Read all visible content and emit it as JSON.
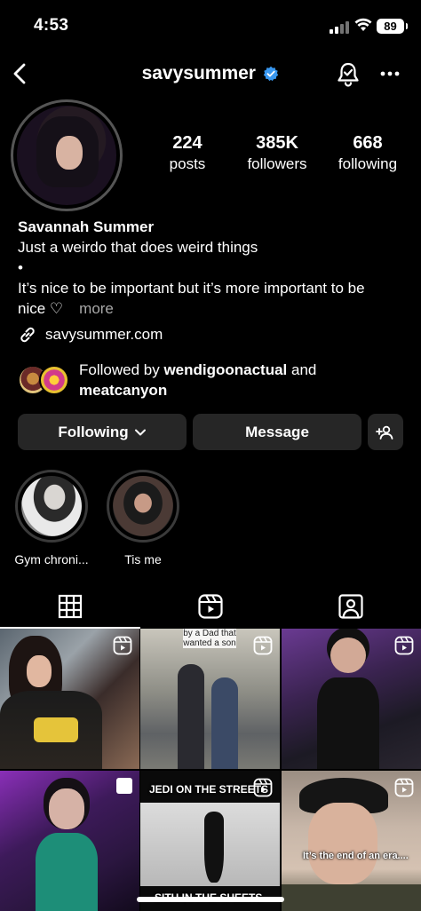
{
  "status_bar": {
    "time": "4:53",
    "battery": "89"
  },
  "header": {
    "username": "savysummer"
  },
  "stats": [
    {
      "value": "224",
      "label": "posts"
    },
    {
      "value": "385K",
      "label": "followers"
    },
    {
      "value": "668",
      "label": "following"
    }
  ],
  "bio": {
    "name": "Savannah Summer",
    "line1": "Just a weirdo that does weird things",
    "line2": "•",
    "line3": "It’s nice to be important but it’s more important to be",
    "line4": "nice ♡",
    "more": "more"
  },
  "link": {
    "text": "savysummer.com"
  },
  "followed_by": {
    "prefix": "Followed by ",
    "user1": "wendigoonactual",
    "joiner": " and",
    "user2": "meatcanyon"
  },
  "actions": {
    "following": "Following",
    "message": "Message"
  },
  "highlights": [
    {
      "label": "Gym chroni..."
    },
    {
      "label": "Tis me"
    }
  ],
  "grid": {
    "captions": {
      "top_cell2": "by a Dad that wanted a son",
      "cell5_top": "JEDI ON THE STREETS",
      "cell5_bottom": "SITH IN THE SHEETS",
      "cell6": "It’s the end of an era...."
    }
  },
  "colors": {
    "background": "#000000",
    "button": "#262626",
    "verified": "#3897f0",
    "muted": "#a8a8a8"
  }
}
